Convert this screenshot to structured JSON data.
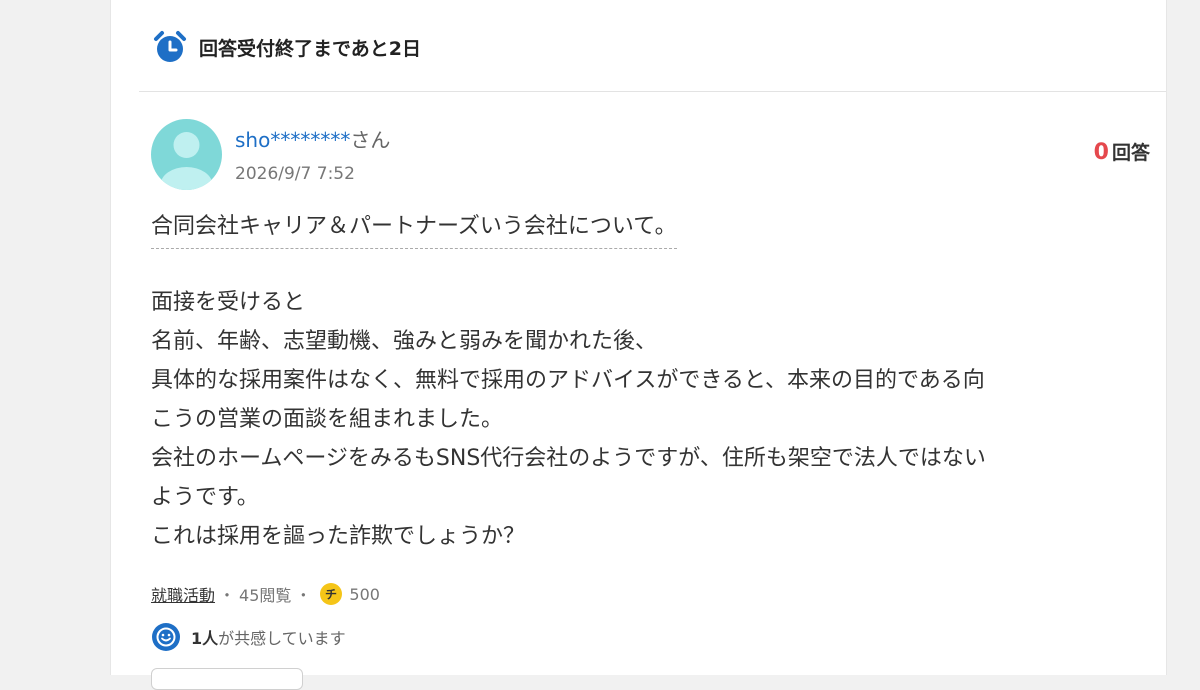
{
  "deadline": {
    "text": "回答受付終了まであと2日",
    "icon": "alarm-clock-icon"
  },
  "question": {
    "user_id": "sho********",
    "user_suffix": "さん",
    "date": "2026/9/7 7:52",
    "answers_count": "0",
    "answers_label": "回答",
    "title": "合同会社キャリア＆パートナーズいう会社について。",
    "body_lines": [
      "面接を受けると",
      "名前、年齢、志望動機、強みと弱みを聞かれた後、",
      "具体的な採用案件はなく、無料で採用のアドバイスができると、本来の目的である向",
      "こうの営業の面談を組まれました。",
      "会社のホームページをみるもSNS代行会社のようですが、住所も架空で法人ではない",
      "ようです。",
      "これは採用を謳った詐欺でしょうか？"
    ]
  },
  "meta": {
    "category": "就職活動",
    "separator": "・",
    "views": "45閲覧",
    "coin_glyph": "チ",
    "coins": "500"
  },
  "empathy": {
    "count": "1人",
    "label": "が共感しています"
  },
  "colors": {
    "accent_blue": "#1e6fc6",
    "answer_red": "#e5484d",
    "avatar_teal": "#7fd8d8",
    "coin_yellow": "#f5c518"
  }
}
